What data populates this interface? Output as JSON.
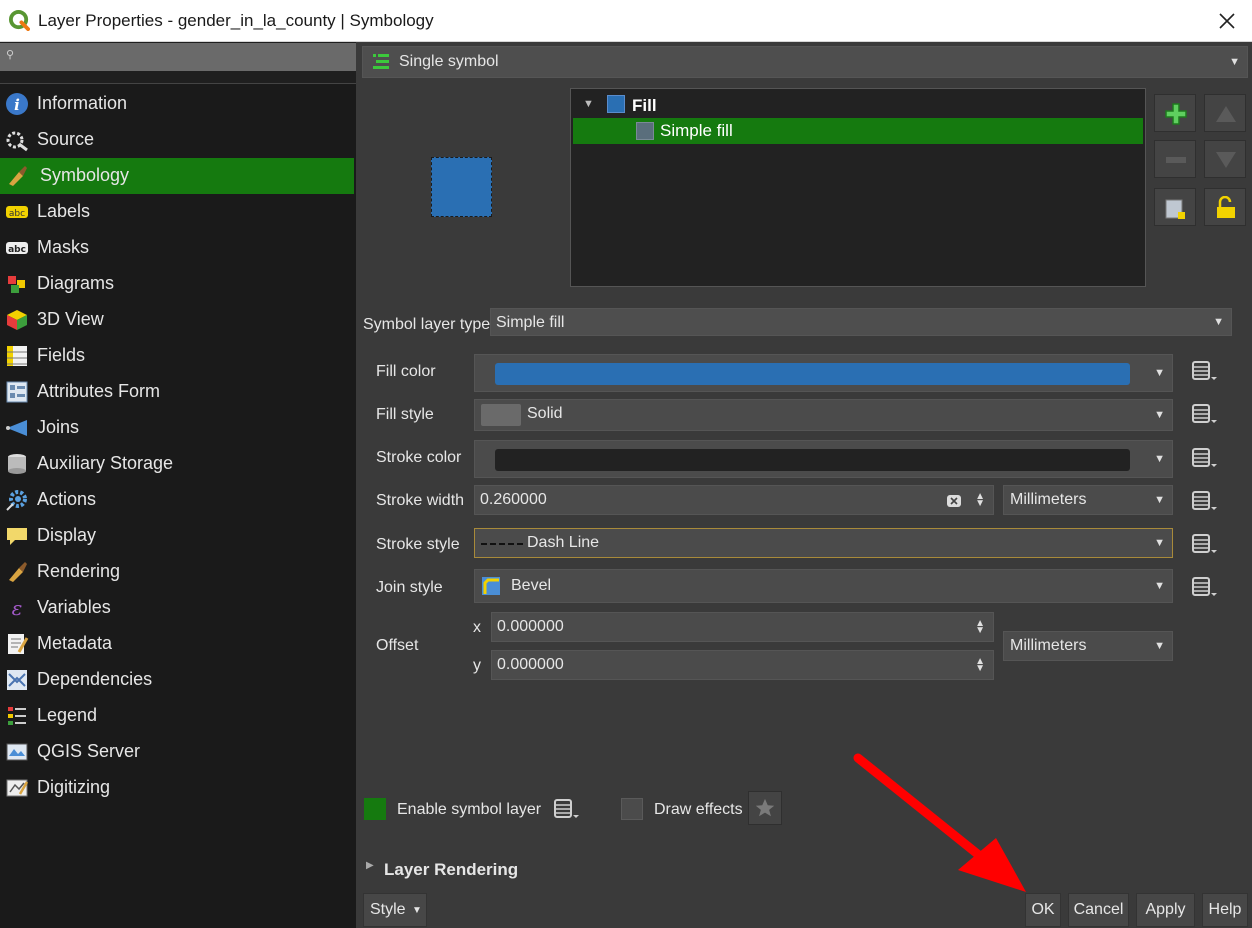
{
  "window": {
    "title": "Layer Properties - gender_in_la_county | Symbology"
  },
  "sidebar": {
    "search_placeholder": "",
    "items": [
      {
        "label": "Information",
        "icon": "info-icon"
      },
      {
        "label": "Source",
        "icon": "source-icon"
      },
      {
        "label": "Symbology",
        "icon": "paintbrush-icon",
        "active": true
      },
      {
        "label": "Labels",
        "icon": "labels-icon"
      },
      {
        "label": "Masks",
        "icon": "masks-icon"
      },
      {
        "label": "Diagrams",
        "icon": "diagrams-icon"
      },
      {
        "label": "3D View",
        "icon": "cube-icon"
      },
      {
        "label": "Fields",
        "icon": "fields-icon"
      },
      {
        "label": "Attributes Form",
        "icon": "form-icon"
      },
      {
        "label": "Joins",
        "icon": "joins-icon"
      },
      {
        "label": "Auxiliary Storage",
        "icon": "storage-icon"
      },
      {
        "label": "Actions",
        "icon": "gear-icon"
      },
      {
        "label": "Display",
        "icon": "speech-bubble-icon"
      },
      {
        "label": "Rendering",
        "icon": "paintbrush-icon"
      },
      {
        "label": "Variables",
        "icon": "epsilon-icon"
      },
      {
        "label": "Metadata",
        "icon": "metadata-icon"
      },
      {
        "label": "Dependencies",
        "icon": "dependencies-icon"
      },
      {
        "label": "Legend",
        "icon": "legend-icon"
      },
      {
        "label": "QGIS Server",
        "icon": "server-icon"
      },
      {
        "label": "Digitizing",
        "icon": "digitizing-icon"
      }
    ]
  },
  "symbology": {
    "renderer": "Single symbol",
    "tree": {
      "root": "Fill",
      "child": "Simple fill"
    },
    "symbol_layer_type_label": "Symbol layer type",
    "symbol_layer_type": "Simple fill",
    "fill_color_label": "Fill color",
    "fill_color": "#2a6fb3",
    "fill_style_label": "Fill style",
    "fill_style": "Solid",
    "stroke_color_label": "Stroke color",
    "stroke_color": "#222222",
    "stroke_width_label": "Stroke width",
    "stroke_width": "0.260000",
    "stroke_width_unit": "Millimeters",
    "stroke_style_label": "Stroke style",
    "stroke_style": "Dash Line",
    "join_style_label": "Join style",
    "join_style": "Bevel",
    "offset_label": "Offset",
    "offset_x_label": "x",
    "offset_x": "0.000000",
    "offset_y_label": "y",
    "offset_y": "0.000000",
    "offset_unit": "Millimeters",
    "enable_symbol_layer": "Enable symbol layer",
    "draw_effects": "Draw effects",
    "layer_rendering": "Layer Rendering"
  },
  "buttons": {
    "style": "Style",
    "ok": "OK",
    "cancel": "Cancel",
    "apply": "Apply",
    "help": "Help"
  },
  "colors": {
    "accent_green": "#157a0f",
    "arrow_red": "#ff0000"
  }
}
